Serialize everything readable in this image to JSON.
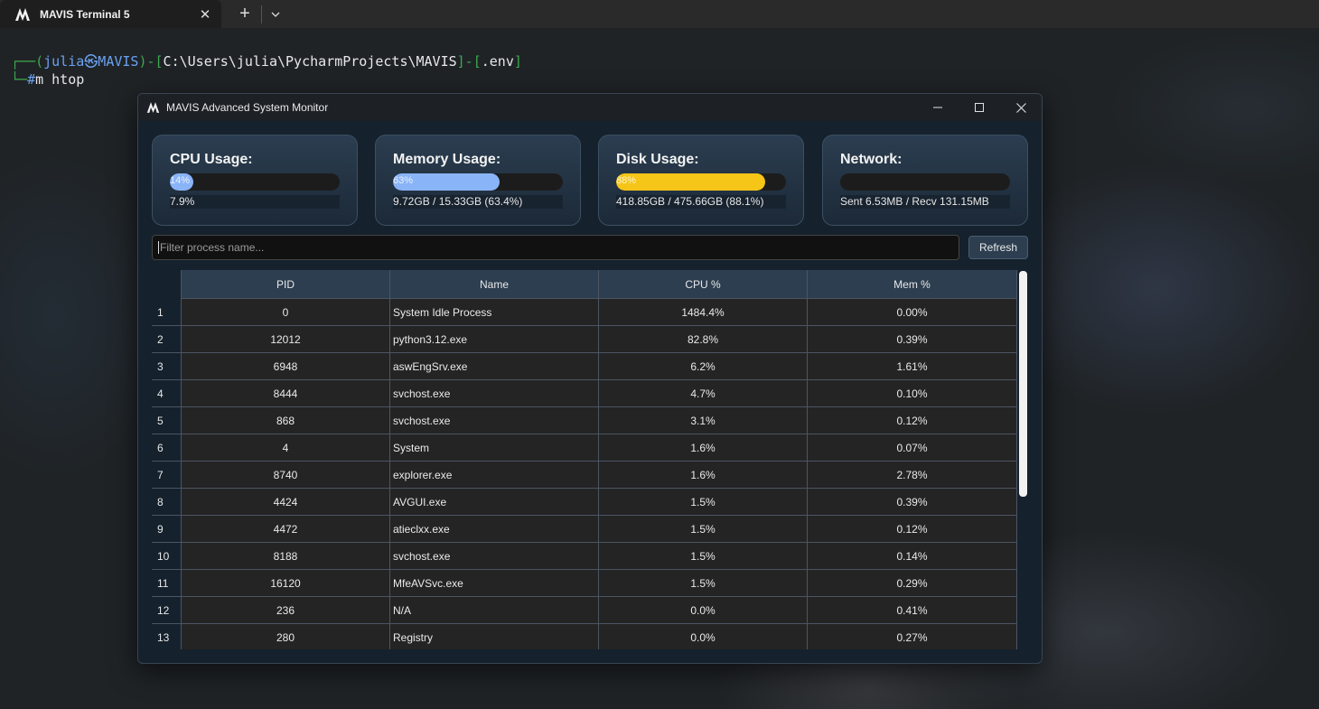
{
  "terminal_tab": {
    "title": "MAVIS Terminal 5",
    "close_glyph": "✕",
    "new_tab_glyph": "+"
  },
  "terminal": {
    "prompt_user": "julia",
    "prompt_host": "MAVIS",
    "prompt_path": "C:\\Users\\julia\\PycharmProjects\\MAVIS",
    "prompt_env": ".env",
    "command": "m htop"
  },
  "window": {
    "title": "MAVIS Advanced System Monitor"
  },
  "cards": {
    "cpu": {
      "label": "CPU Usage:",
      "percent_text": "14%",
      "fill": 0.14,
      "detail": "7.9%",
      "color": "#8ab4f8"
    },
    "memory": {
      "label": "Memory Usage:",
      "percent_text": "63%",
      "fill": 0.63,
      "detail": "9.72GB / 15.33GB (63.4%)",
      "color": "#8ab4f8"
    },
    "disk": {
      "label": "Disk Usage:",
      "percent_text": "88%",
      "fill": 0.88,
      "detail": "418.85GB / 475.66GB (88.1%)",
      "color": "#f5c518"
    },
    "network": {
      "label": "Network:",
      "percent_text": "",
      "fill": 0,
      "detail": "Sent 6.53MB / Recv 131.15MB",
      "color": "#8ab4f8"
    }
  },
  "filter": {
    "placeholder": "Filter process name...",
    "refresh_label": "Refresh"
  },
  "table": {
    "columns": [
      "PID",
      "Name",
      "CPU %",
      "Mem %"
    ],
    "rows": [
      {
        "index": "1",
        "pid": "0",
        "name": "System Idle Process",
        "cpu": "1484.4%",
        "mem": "0.00%"
      },
      {
        "index": "2",
        "pid": "12012",
        "name": "python3.12.exe",
        "cpu": "82.8%",
        "mem": "0.39%"
      },
      {
        "index": "3",
        "pid": "6948",
        "name": "aswEngSrv.exe",
        "cpu": "6.2%",
        "mem": "1.61%"
      },
      {
        "index": "4",
        "pid": "8444",
        "name": "svchost.exe",
        "cpu": "4.7%",
        "mem": "0.10%"
      },
      {
        "index": "5",
        "pid": "868",
        "name": "svchost.exe",
        "cpu": "3.1%",
        "mem": "0.12%"
      },
      {
        "index": "6",
        "pid": "4",
        "name": "System",
        "cpu": "1.6%",
        "mem": "0.07%"
      },
      {
        "index": "7",
        "pid": "8740",
        "name": "explorer.exe",
        "cpu": "1.6%",
        "mem": "2.78%"
      },
      {
        "index": "8",
        "pid": "4424",
        "name": "AVGUI.exe",
        "cpu": "1.5%",
        "mem": "0.39%"
      },
      {
        "index": "9",
        "pid": "4472",
        "name": "atieclxx.exe",
        "cpu": "1.5%",
        "mem": "0.12%"
      },
      {
        "index": "10",
        "pid": "8188",
        "name": "svchost.exe",
        "cpu": "1.5%",
        "mem": "0.14%"
      },
      {
        "index": "11",
        "pid": "16120",
        "name": "MfeAVSvc.exe",
        "cpu": "1.5%",
        "mem": "0.29%"
      },
      {
        "index": "12",
        "pid": "236",
        "name": "N/A",
        "cpu": "0.0%",
        "mem": "0.41%"
      },
      {
        "index": "13",
        "pid": "280",
        "name": "Registry",
        "cpu": "0.0%",
        "mem": "0.27%"
      }
    ]
  }
}
